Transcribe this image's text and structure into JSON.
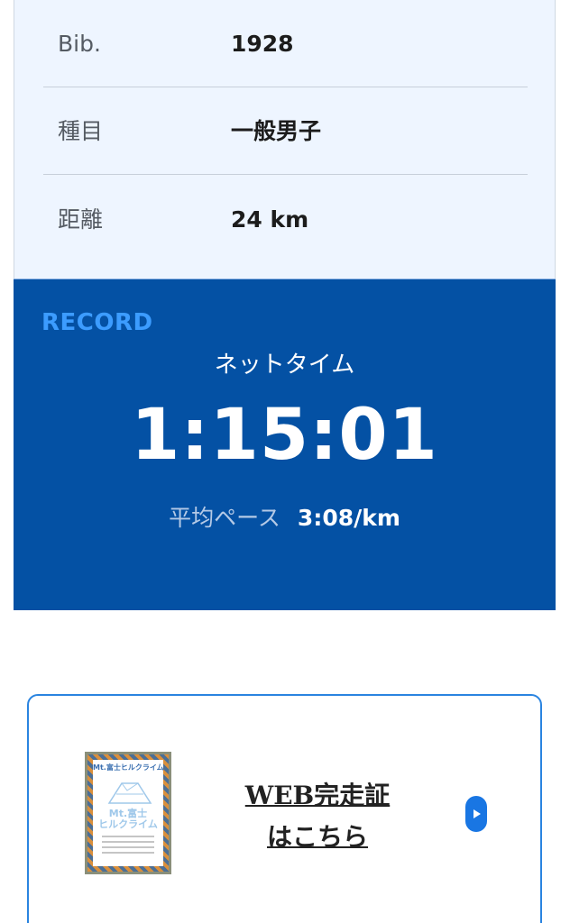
{
  "info": {
    "rows": [
      {
        "label": "Bib.",
        "value": "1928"
      },
      {
        "label": "種目",
        "value": "一般男子"
      },
      {
        "label": "距離",
        "value": "24 km"
      }
    ]
  },
  "record": {
    "label": "RECORD",
    "net_time_label": "ネットタイム",
    "net_time": "1:15:01",
    "pace_label": "平均ペース",
    "pace_value": "3:08/km"
  },
  "certificate": {
    "title_line1": "WEB完走証",
    "title_line2": "はこちら",
    "thumbnail_brand": "Mt.富士ヒルクライム",
    "thumbnail_logo_line1": "Mt.富士",
    "thumbnail_logo_line2": "ヒルクライム",
    "play_icon": "play-icon"
  },
  "colors": {
    "record_bg": "#0451a4",
    "record_label": "#3c9cff",
    "info_bg": "#eef5ff",
    "accent": "#1976e3"
  }
}
